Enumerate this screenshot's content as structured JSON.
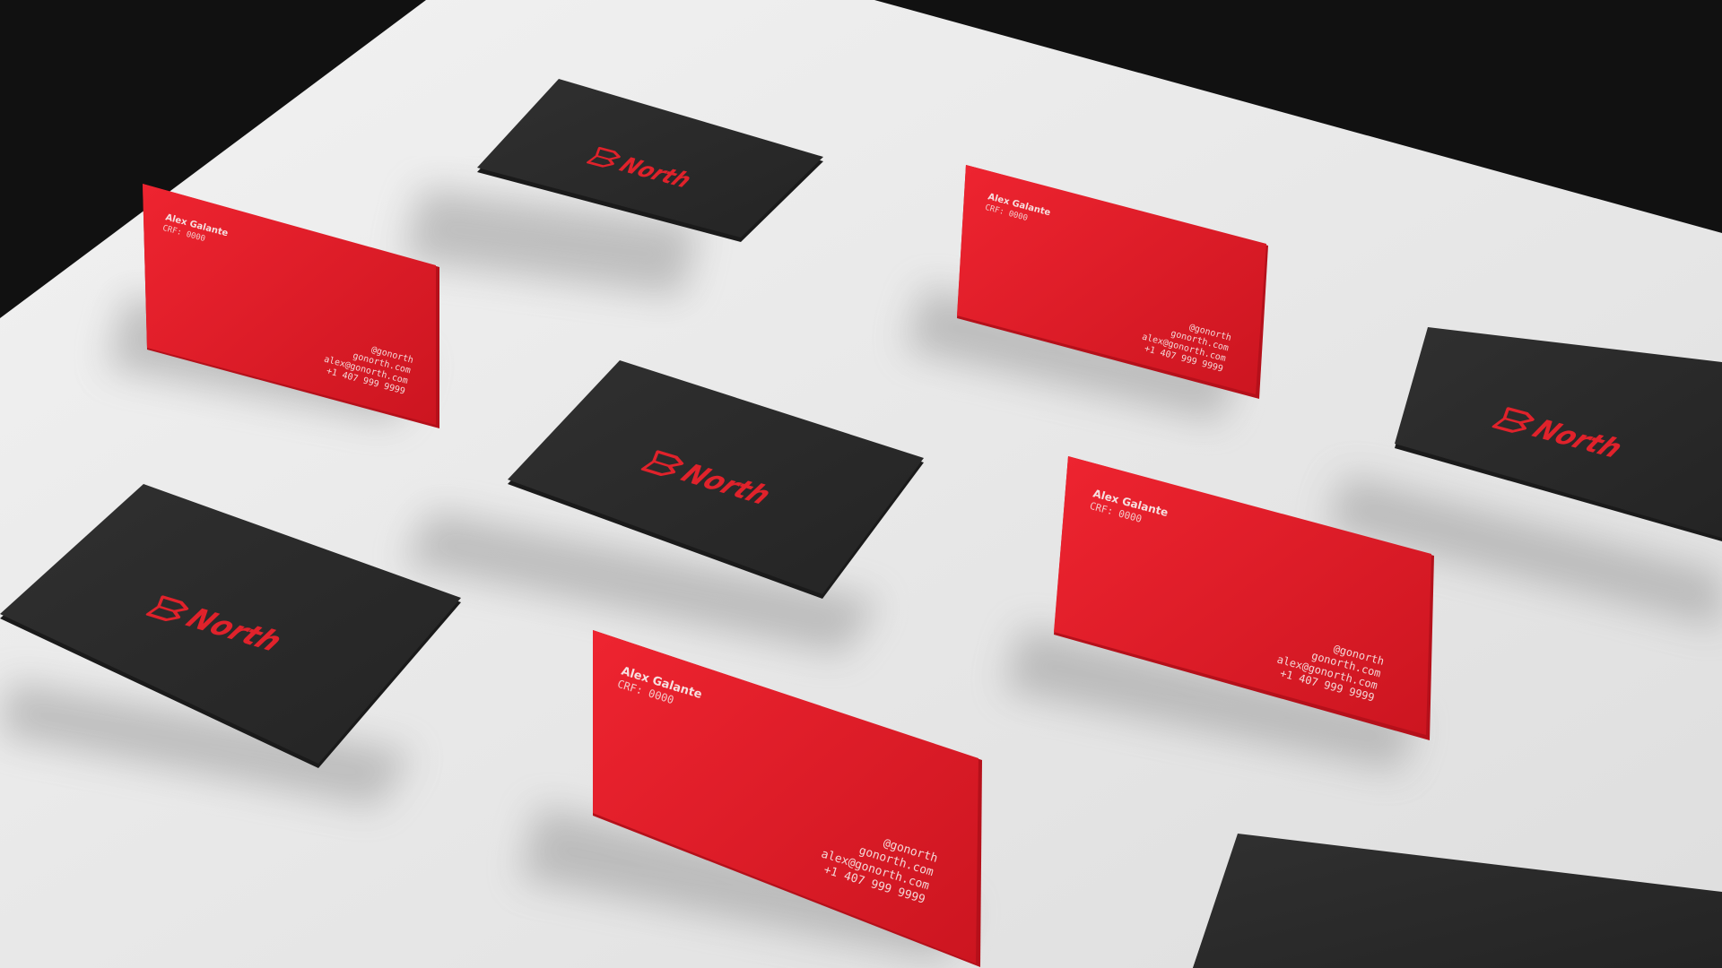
{
  "colors": {
    "background_dark": "#111111",
    "surface": "#e8e8e8",
    "card_red": "#e21a26",
    "card_black": "#2a2a2a",
    "logo_red": "#e0222b",
    "text_light": "#f3d6d6"
  },
  "brand": {
    "name": "North",
    "logo_icon": "north-logo-mark-icon"
  },
  "card_front": {
    "name": "Alex Galante",
    "id_line": "CRF: 0000",
    "handle": "@gonorth",
    "website": "gonorth.com",
    "email": "alex@gonorth.com",
    "phone": "+1 407 999 9999"
  }
}
